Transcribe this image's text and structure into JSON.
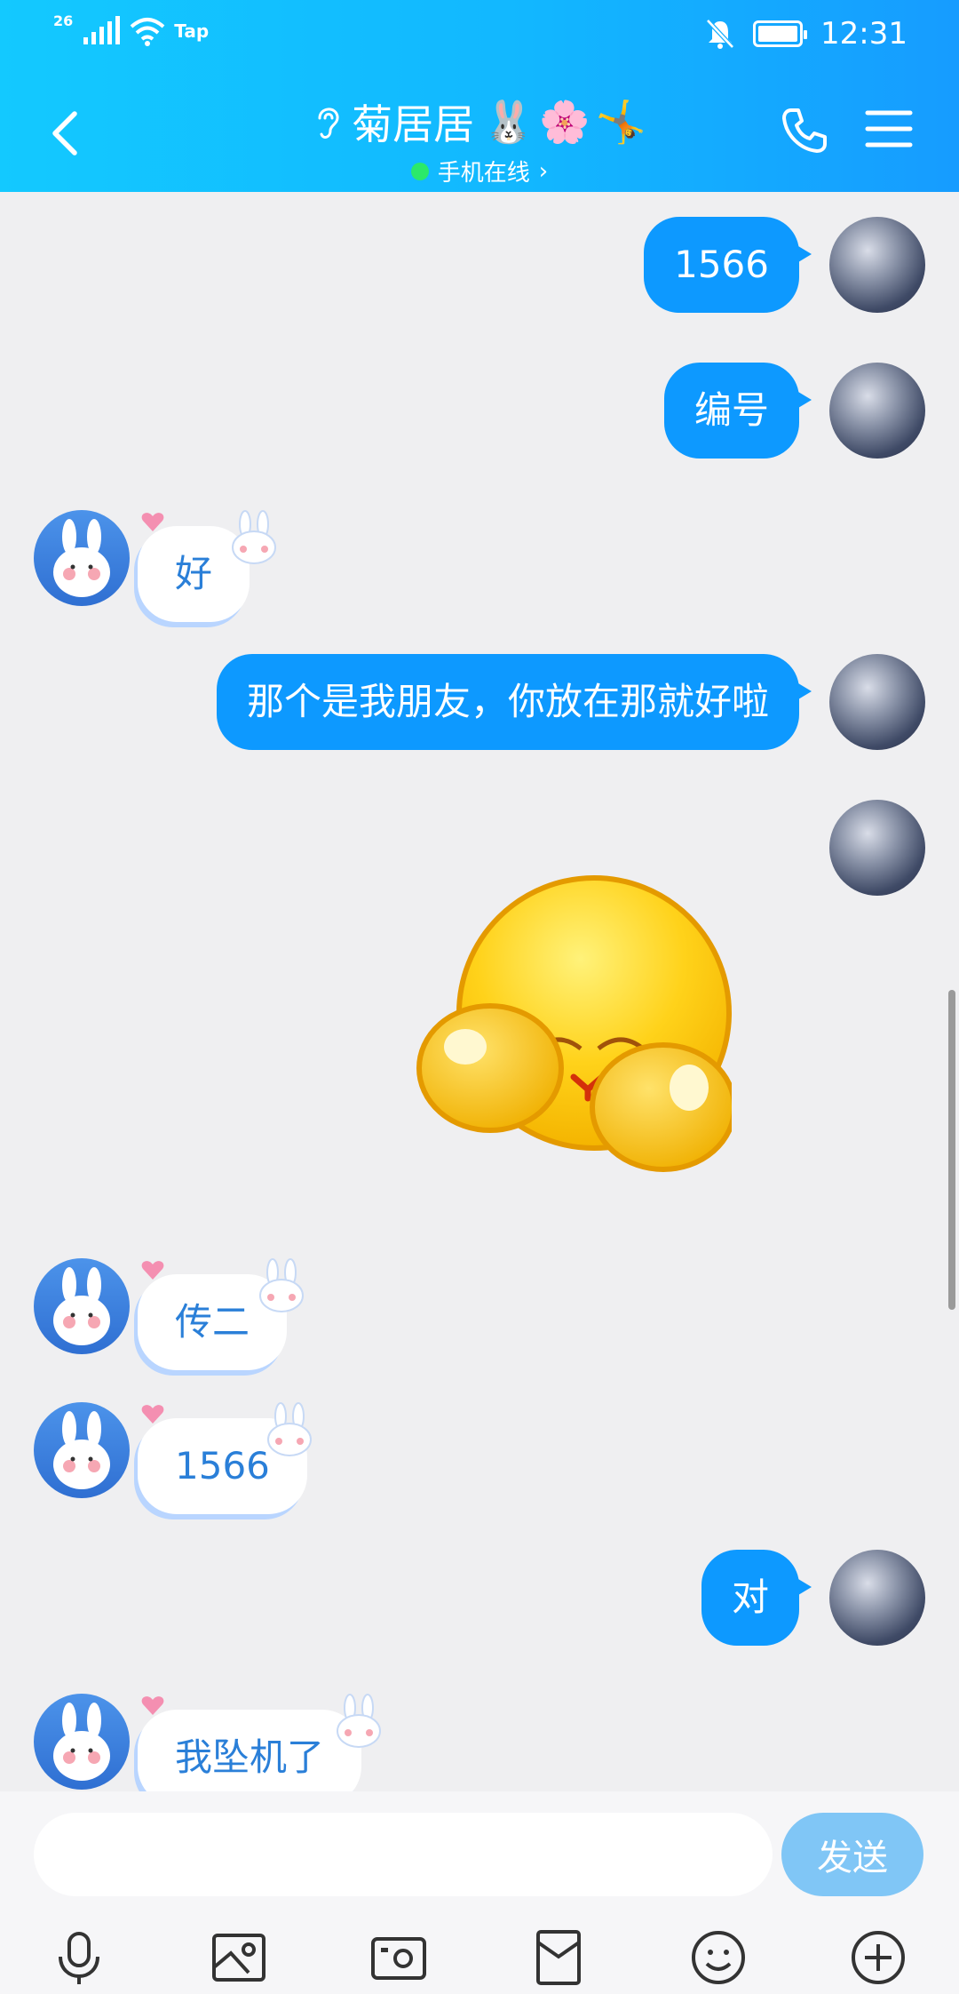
{
  "status_bar": {
    "network": "26",
    "carrier": "Tap",
    "time": "12:31"
  },
  "header": {
    "title": "菊居居",
    "title_emojis": [
      "🐰",
      "🌸",
      "🤸"
    ],
    "subtitle": "手机在线",
    "subtitle_chevron": "›"
  },
  "messages": [
    {
      "side": "me",
      "text": "1566"
    },
    {
      "side": "me",
      "text": "编号"
    },
    {
      "side": "other",
      "text": "好"
    },
    {
      "side": "me",
      "text": "那个是我朋友，你放在那就好啦"
    },
    {
      "side": "me",
      "type": "sticker",
      "sticker": "covering-face-emoji"
    },
    {
      "side": "other",
      "text": "传二"
    },
    {
      "side": "other",
      "text": "1566"
    },
    {
      "side": "me",
      "text": "对"
    },
    {
      "side": "other",
      "text": "我坠机了"
    }
  ],
  "input": {
    "value": "",
    "placeholder": "",
    "send_label": "发送"
  },
  "toolbar": {
    "icons": [
      "microphone-icon",
      "image-icon",
      "camera-icon",
      "red-packet-icon",
      "emoji-icon",
      "plus-icon"
    ]
  },
  "colors": {
    "header_start": "#13c9ff",
    "header_end": "#169cff",
    "my_bubble": "#0d99ff",
    "other_text": "#2a7fd8",
    "send_button": "#80c6f6",
    "online": "#2be96a"
  }
}
